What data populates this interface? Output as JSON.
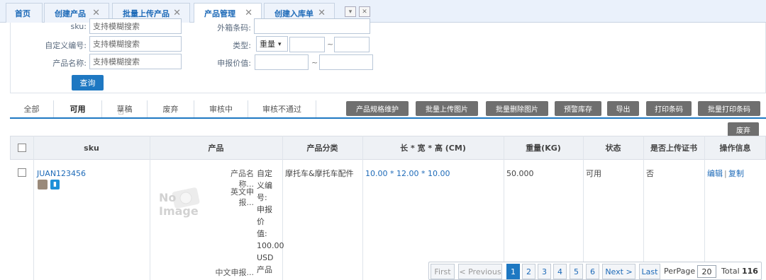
{
  "tabs": [
    {
      "label": "首页"
    },
    {
      "label": "创建产品"
    },
    {
      "label": "批量上传产品"
    },
    {
      "label": "产品管理"
    },
    {
      "label": "创建入库单"
    }
  ],
  "form": {
    "sku_label": "sku:",
    "sku_placeholder": "支持模糊搜索",
    "custom_code_label": "自定义编号:",
    "custom_code_placeholder": "支持模糊搜索",
    "product_name_label": "产品名称:",
    "product_name_placeholder": "支持模糊搜索",
    "outer_barcode_label": "外箱条码:",
    "type_label": "类型:",
    "type_selected": "重量",
    "range_sep": "~",
    "declared_value_label": "申报价值:",
    "query_button": "查询"
  },
  "status_tabs": [
    "全部",
    "可用",
    "草稿",
    "废弃",
    "审核中",
    "审核不通过"
  ],
  "actions": [
    "产品规格维护",
    "批量上传图片",
    "批量删除图片",
    "预警库存",
    "导出",
    "打印条码",
    "批量打印条码"
  ],
  "discard_button": "废弃",
  "table": {
    "headers": [
      "sku",
      "产品",
      "产品分类",
      "长 * 宽 * 高 (CM)",
      "重量(KG)",
      "状态",
      "是否上传证书",
      "操作信息"
    ],
    "row": {
      "sku": "JUAN123456",
      "no_image": "No Image",
      "field_labels": [
        "产品名称...",
        "英文申报...",
        "中文申报..."
      ],
      "field_value_lines": [
        "自定",
        "义编",
        "号:",
        "申报",
        "价",
        "值:",
        "100.00",
        "USD",
        "产品"
      ],
      "category": "摩托车&摩托车配件",
      "dimensions": "10.00 * 12.00 * 10.00",
      "weight": "50.000",
      "status": "可用",
      "certificate": "否",
      "edit": "编辑",
      "sep": "|",
      "copy": "复制"
    }
  },
  "pager": {
    "first": "First",
    "previous": "< Previous",
    "pages": [
      "1",
      "2",
      "3",
      "4",
      "5",
      "6"
    ],
    "current": "1",
    "next": "Next >",
    "last": "Last",
    "perpage_label": "PerPage",
    "perpage_value": "20",
    "total_label": "Total",
    "total_value": "116"
  },
  "colors": {
    "accent": "#1e78c2",
    "tab_text": "#1d6ab8",
    "action_button": "#6f6f6f"
  }
}
